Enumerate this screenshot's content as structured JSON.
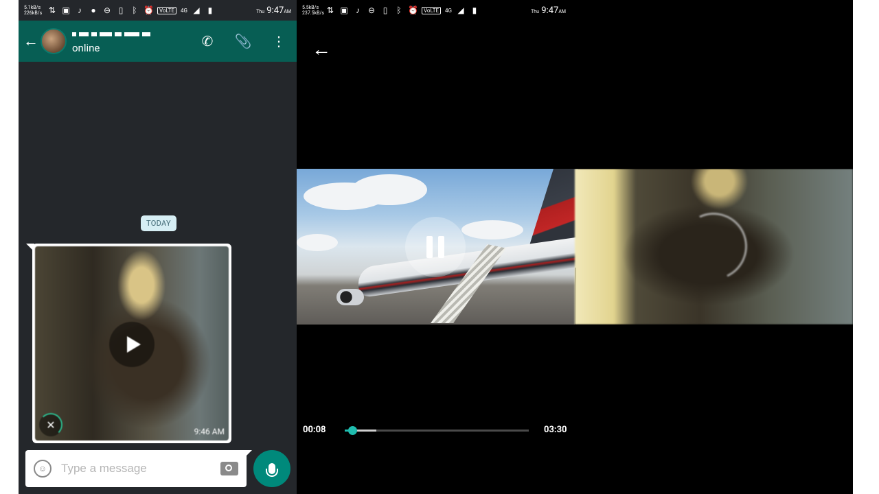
{
  "status_bar_left": {
    "rate_up": "5.1kB/s",
    "rate_down": "226kB/s",
    "network": "4G",
    "volte": "VoLTE",
    "day": "Thu",
    "time": "9:47",
    "ampm": "AM"
  },
  "status_bar_right": {
    "rate_up": "5.5kB/s",
    "rate_down": "237.5kB/s",
    "network": "4G",
    "volte": "VoLTE",
    "day": "Thu",
    "time": "9:47",
    "ampm": "AM"
  },
  "chat_header": {
    "contact_status": "online",
    "icons": [
      "back-arrow-icon",
      "phone-icon",
      "paperclip-icon",
      "more-vert-icon"
    ],
    "accent_color": "#075e54"
  },
  "chat": {
    "date_chip": "TODAY",
    "media_message": {
      "time": "9:46 AM",
      "download_state": "downloading"
    }
  },
  "composer": {
    "placeholder": "Type a message",
    "mic_color": "#00897b"
  },
  "player": {
    "current_time": "00:08",
    "duration": "03:30",
    "played_fraction": 0.04,
    "buffered_fraction": 0.17,
    "accent_color": "#1fbcae"
  }
}
